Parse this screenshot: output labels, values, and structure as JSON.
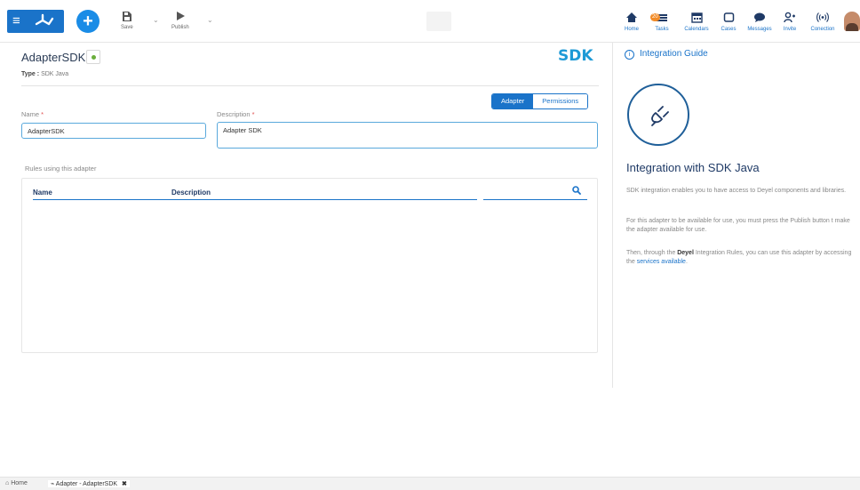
{
  "toolbar": {
    "save_label": "Save",
    "publish_label": "Publish"
  },
  "nav": {
    "home": "Home",
    "tasks": "Tasks",
    "tasks_badge": "20",
    "calendars": "Calendars",
    "cases": "Cases",
    "messages": "Messages",
    "invite": "Invite",
    "connection": "Conection"
  },
  "form": {
    "title": "AdapterSDK",
    "type_label": "Type :",
    "type_value": "SDK Java",
    "brand": "SDK",
    "tabs": [
      "Adapter",
      "Permissions"
    ],
    "active_tab": "Adapter",
    "name_label": "Name",
    "name_value": "AdapterSDK",
    "description_label": "Description",
    "description_value": "Adapter SDK",
    "required_mark": "*"
  },
  "rules": {
    "label": "Rules using this adapter",
    "columns": [
      "Name",
      "Description"
    ],
    "rows": []
  },
  "guide": {
    "header": "Integration Guide",
    "title": "Integration with SDK Java",
    "p1": "SDK integration enables you to have access to Deyel components and libraries.",
    "p2": "For this adapter to be available for use, you must press the Publish button t make the adapter available for use.",
    "p3_start": "Then, through the ",
    "p3_bold": "Deyel",
    "p3_mid": " Integration Rules, you can use this adapter by accessing the ",
    "p3_link": "services available",
    "p3_end": "."
  },
  "footer": {
    "home_tab": "Home",
    "active_tab": "Adapter - AdapterSDK"
  },
  "colors": {
    "primary": "#1a73c9",
    "brand_sdk": "#1e9ad6",
    "status_ok": "#6aae3b",
    "badge": "#f28c28"
  },
  "icons": [
    "menu-icon",
    "deyel-logo-icon",
    "plus-icon",
    "save-icon",
    "publish-icon",
    "home-icon",
    "tasks-icon",
    "calendar-icon",
    "cases-icon",
    "messages-icon",
    "invite-icon",
    "connection-icon",
    "info-icon",
    "plug-icon",
    "search-icon",
    "close-icon"
  ]
}
